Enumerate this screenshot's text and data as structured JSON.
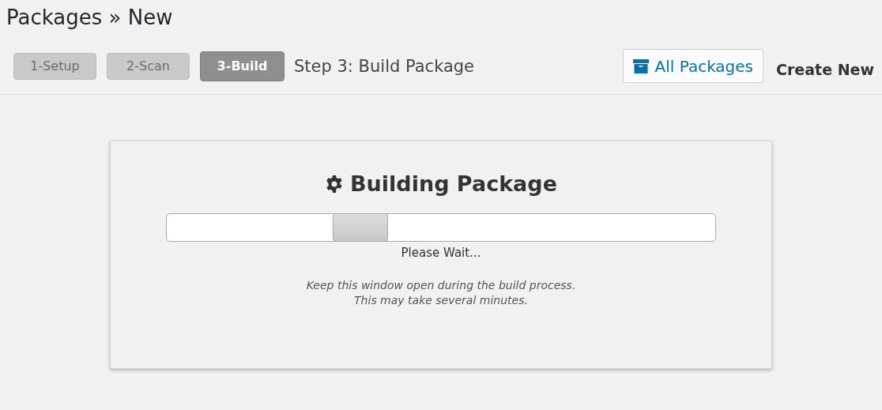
{
  "page_title": "Packages » New",
  "steps": [
    {
      "label": "1-Setup",
      "selected": false
    },
    {
      "label": "2-Scan",
      "selected": false
    },
    {
      "label": "3-Build",
      "selected": true
    }
  ],
  "step_title": "Step 3: Build Package",
  "actions": {
    "all_packages": "All Packages",
    "create_new": "Create New"
  },
  "card": {
    "heading": "Building Package",
    "status": "Please Wait...",
    "notes": [
      "Keep this window open during the build process.",
      "This may take several minutes."
    ]
  }
}
